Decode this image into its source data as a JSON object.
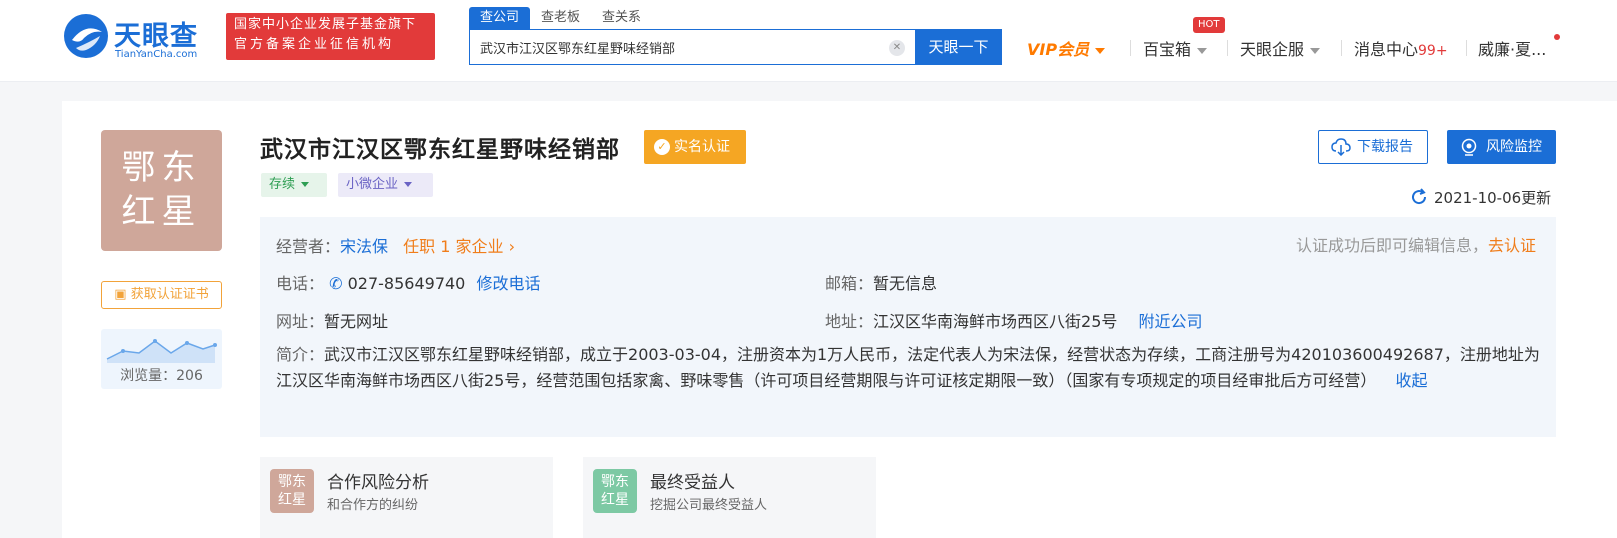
{
  "header": {
    "logo_cn": "天眼查",
    "logo_en": "TianYanCha.com",
    "banner_line1": "国家中小企业发展子基金旗下",
    "banner_line2": "官方备案企业征信机构",
    "search_tabs": [
      "查公司",
      "查老板",
      "查关系"
    ],
    "search_value": "武汉市江汉区鄂东红星野味经销部",
    "search_button": "天眼一下",
    "nav": {
      "vip": "VIP会员",
      "treasure": "百宝箱",
      "hot_badge": "HOT",
      "enterprise": "天眼企服",
      "messages": "消息中心",
      "messages_count": "99+",
      "user": "威廉·夏..."
    }
  },
  "company": {
    "avatar_line1": "鄂东",
    "avatar_line2": "红星",
    "name": "武汉市江汉区鄂东红星野味经销部",
    "verified_label": "实名认证",
    "status_tag": "存续",
    "size_tag": "小微企业",
    "cert_button": "获取认证证书",
    "views_label": "浏览量：206",
    "download_button": "下载报告",
    "risk_button": "风险监控",
    "updated": "2021-10-06更新"
  },
  "info": {
    "operator_label": "经营者：",
    "operator_name": "宋法保",
    "operator_jobs": "任职 1 家企业",
    "edit_hint": "认证成功后即可编辑信息，",
    "edit_link": "去认证",
    "phone_label": "电话：",
    "phone_value": "027-85649740",
    "phone_edit": "修改电话",
    "email_label": "邮箱：",
    "email_value": "暂无信息",
    "website_label": "网址：",
    "website_value": "暂无网址",
    "address_label": "地址：",
    "address_value": "江汉区华南海鲜市场西区八街25号",
    "nearby_link": "附近公司",
    "intro_label": "简介：",
    "intro_text": "武汉市江汉区鄂东红星野味经销部，成立于2003-03-04，注册资本为1万人民币，法定代表人为宋法保，经营状态为存续，工商注册号为420103600492687，注册地址为江汉区华南海鲜市场西区八街25号，经营范围包括家禽、野味零售（许可项目经营期限与许可证核定期限一致）（国家有专项规定的项目经审批后方可经营）",
    "collapse_link": "收起"
  },
  "bottom_cards": [
    {
      "avatar_line1": "鄂东",
      "avatar_line2": "红星",
      "title": "合作风险分析",
      "subtitle": "和合作方的纠纷",
      "color": "#cfa79a"
    },
    {
      "avatar_line1": "鄂东",
      "avatar_line2": "红星",
      "title": "最终受益人",
      "subtitle": "挖掘公司最终受益人",
      "color": "#7dc9a4"
    }
  ]
}
